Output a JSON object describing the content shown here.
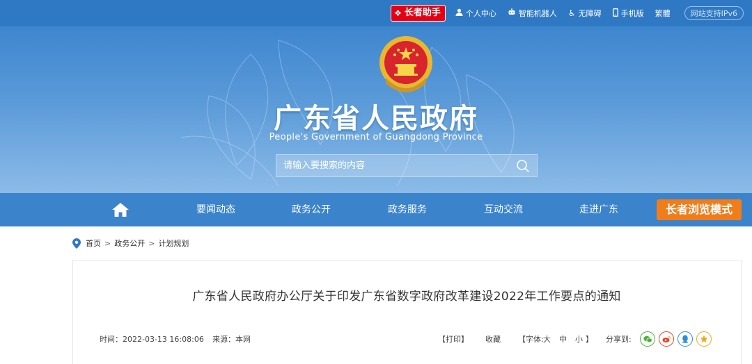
{
  "topbar": {
    "elder_helper": "长者助手",
    "links": [
      "个人中心",
      "智能机器人",
      "无障碍",
      "手机版",
      "繁體"
    ],
    "ipv6": "网站支持IPv6"
  },
  "banner": {
    "title": "广东省人民政府",
    "subtitle": "People's Government of Guangdong Province",
    "search_placeholder": "请输入要搜索的内容"
  },
  "nav": {
    "items": [
      "要闻动态",
      "政务公开",
      "政务服务",
      "互动交流",
      "走进广东"
    ],
    "elder_mode": "长者浏览模式"
  },
  "breadcrumb": [
    "首页",
    "政务公开",
    "计划规划"
  ],
  "article": {
    "title": "广东省人民政府办公厅关于印发广东省数字政府改革建设2022年工作要点的通知",
    "time": "时间：2022-03-13 16:08:06",
    "source": "来源：本网",
    "print": "【打印】",
    "favorite": "收藏",
    "font_label": "【字体:",
    "font_large": "大",
    "font_medium": "中",
    "font_small": "小",
    "font_close": "】",
    "share_label": "分享到:"
  },
  "colors": {
    "topbar": "#2f79c4",
    "nav": "#3b83cb",
    "elder_red": "#e60012",
    "elder_orange": "#f07d1a"
  }
}
